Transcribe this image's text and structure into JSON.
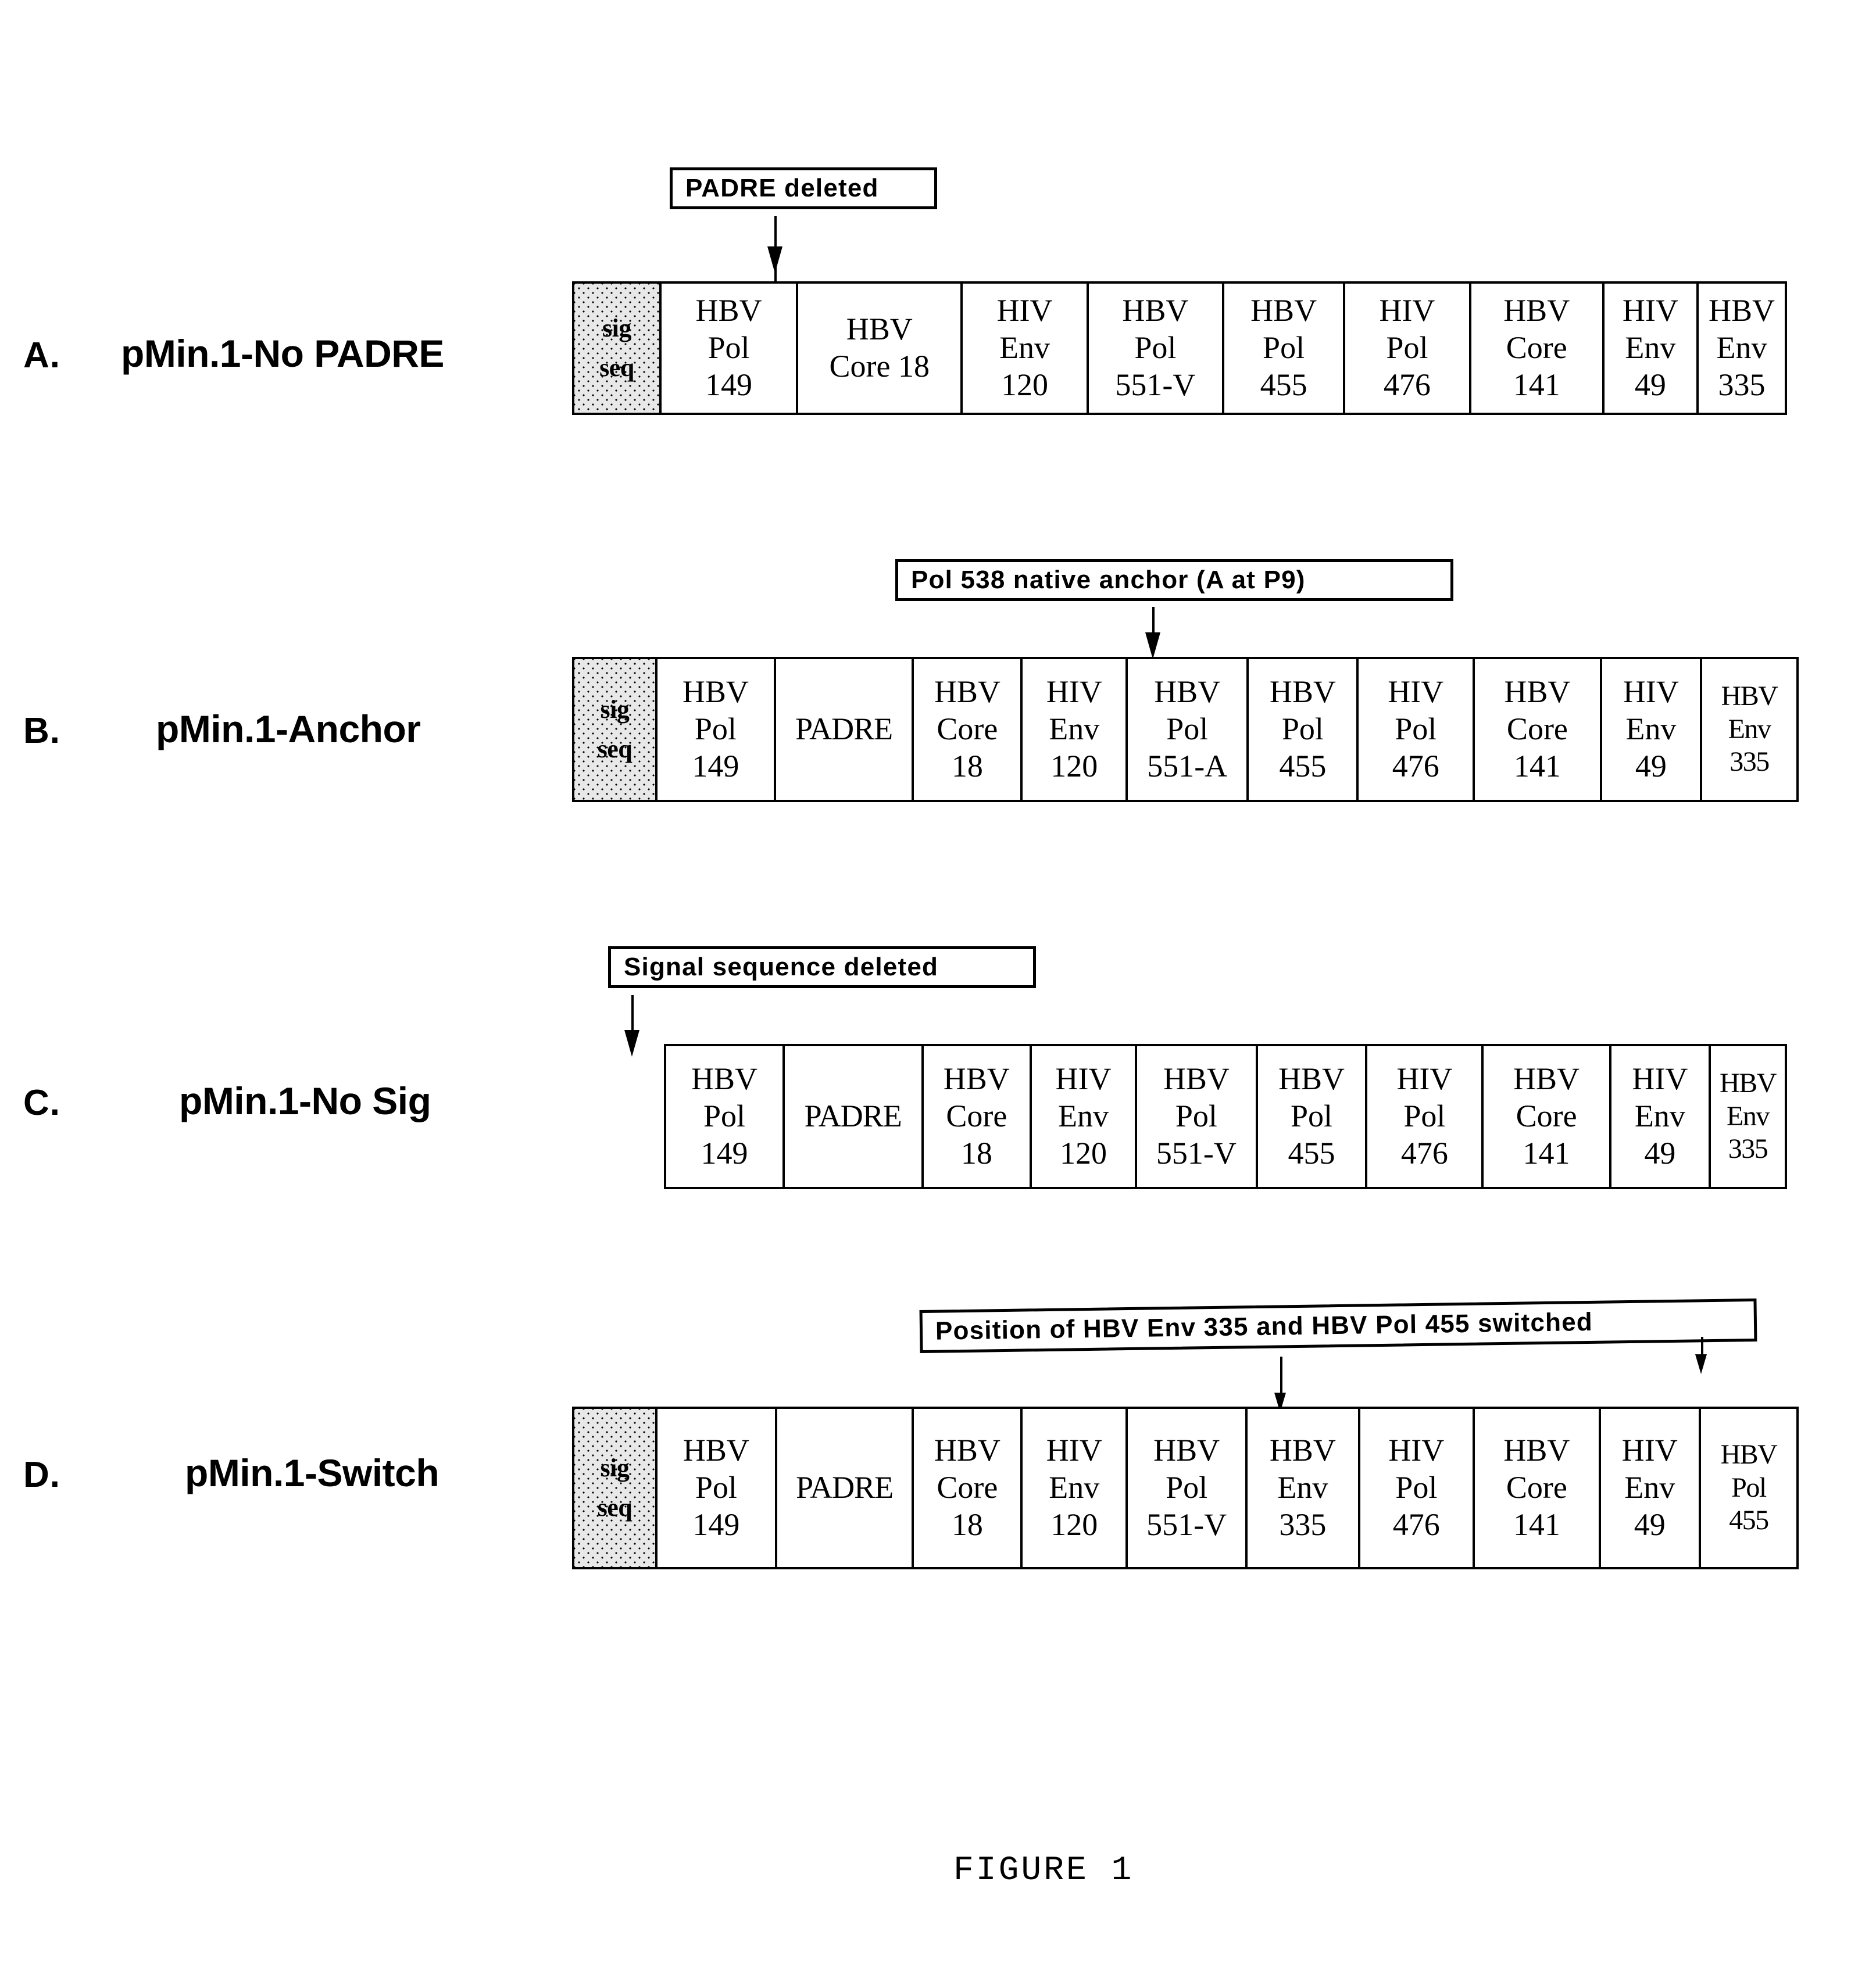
{
  "figure": {
    "caption": "FIGURE 1"
  },
  "panels": [
    {
      "letter": "A.",
      "title": "pMin.1-No PADRE",
      "callout": "PADRE deleted",
      "cells": [
        {
          "lines": [
            "sig",
            "seq"
          ],
          "style": "sig"
        },
        {
          "lines": [
            "HBV",
            "Pol",
            "149"
          ],
          "style": "triple"
        },
        {
          "lines": [
            "HBV",
            "Core 18"
          ],
          "style": "double"
        },
        {
          "lines": [
            "HIV",
            "Env",
            "120"
          ],
          "style": "triple"
        },
        {
          "lines": [
            "HBV",
            "Pol",
            "551-V"
          ],
          "style": "triple"
        },
        {
          "lines": [
            "HBV",
            "Pol",
            "455"
          ],
          "style": "triple"
        },
        {
          "lines": [
            "HIV",
            "Pol",
            "476"
          ],
          "style": "triple"
        },
        {
          "lines": [
            "HBV",
            "Core",
            "141"
          ],
          "style": "triple"
        },
        {
          "lines": [
            "HIV",
            "Env",
            "49"
          ],
          "style": "triple"
        },
        {
          "lines": [
            "HBV",
            "Env",
            "335"
          ],
          "style": "triple"
        }
      ]
    },
    {
      "letter": "B.",
      "title": "pMin.1-Anchor",
      "callout": "Pol 538 native anchor (A at P9)",
      "cells": [
        {
          "lines": [
            "sig",
            "seq"
          ],
          "style": "sig"
        },
        {
          "lines": [
            "HBV",
            "Pol",
            "149"
          ],
          "style": "triple"
        },
        {
          "lines": [
            "PADRE"
          ],
          "style": "single"
        },
        {
          "lines": [
            "HBV",
            "Core",
            "18"
          ],
          "style": "triple"
        },
        {
          "lines": [
            "HIV",
            "Env",
            "120"
          ],
          "style": "triple"
        },
        {
          "lines": [
            "HBV",
            "Pol",
            "551-A"
          ],
          "style": "triple"
        },
        {
          "lines": [
            "HBV",
            "Pol",
            "455"
          ],
          "style": "triple"
        },
        {
          "lines": [
            "HIV",
            "Pol",
            "476"
          ],
          "style": "triple"
        },
        {
          "lines": [
            "HBV",
            "Core",
            "141"
          ],
          "style": "triple"
        },
        {
          "lines": [
            "HIV",
            "Env",
            "49"
          ],
          "style": "triple"
        },
        {
          "lines": [
            "HBV",
            "Env",
            "335"
          ],
          "style": "triple"
        }
      ]
    },
    {
      "letter": "C.",
      "title": "pMin.1-No Sig",
      "callout": "Signal sequence deleted",
      "cells": [
        {
          "lines": [
            "HBV",
            "Pol",
            "149"
          ],
          "style": "triple"
        },
        {
          "lines": [
            "PADRE"
          ],
          "style": "single"
        },
        {
          "lines": [
            "HBV",
            "Core",
            "18"
          ],
          "style": "triple"
        },
        {
          "lines": [
            "HIV",
            "Env",
            "120"
          ],
          "style": "triple"
        },
        {
          "lines": [
            "HBV",
            "Pol",
            "551-V"
          ],
          "style": "triple"
        },
        {
          "lines": [
            "HBV",
            "Pol",
            "455"
          ],
          "style": "triple"
        },
        {
          "lines": [
            "HIV",
            "Pol",
            "476"
          ],
          "style": "triple"
        },
        {
          "lines": [
            "HBV",
            "Core",
            "141"
          ],
          "style": "triple"
        },
        {
          "lines": [
            "HIV",
            "Env",
            "49"
          ],
          "style": "triple"
        },
        {
          "lines": [
            "HBV",
            "Env",
            "335"
          ],
          "style": "triple"
        }
      ]
    },
    {
      "letter": "D.",
      "title": "pMin.1-Switch",
      "callout": "Position of HBV Env 335 and HBV Pol 455 switched",
      "cells": [
        {
          "lines": [
            "sig",
            "seq"
          ],
          "style": "sig"
        },
        {
          "lines": [
            "HBV",
            "Pol",
            "149"
          ],
          "style": "triple"
        },
        {
          "lines": [
            "PADRE"
          ],
          "style": "single"
        },
        {
          "lines": [
            "HBV",
            "Core",
            "18"
          ],
          "style": "triple"
        },
        {
          "lines": [
            "HIV",
            "Env",
            "120"
          ],
          "style": "triple"
        },
        {
          "lines": [
            "HBV",
            "Pol",
            "551-V"
          ],
          "style": "triple"
        },
        {
          "lines": [
            "HBV",
            "Env",
            "335"
          ],
          "style": "triple"
        },
        {
          "lines": [
            "HIV",
            "Pol",
            "476"
          ],
          "style": "triple"
        },
        {
          "lines": [
            "HBV",
            "Core",
            "141"
          ],
          "style": "triple"
        },
        {
          "lines": [
            "HIV",
            "Env",
            "49"
          ],
          "style": "triple"
        },
        {
          "lines": [
            "HBV",
            "Pol",
            "455"
          ],
          "style": "triple"
        }
      ]
    }
  ]
}
